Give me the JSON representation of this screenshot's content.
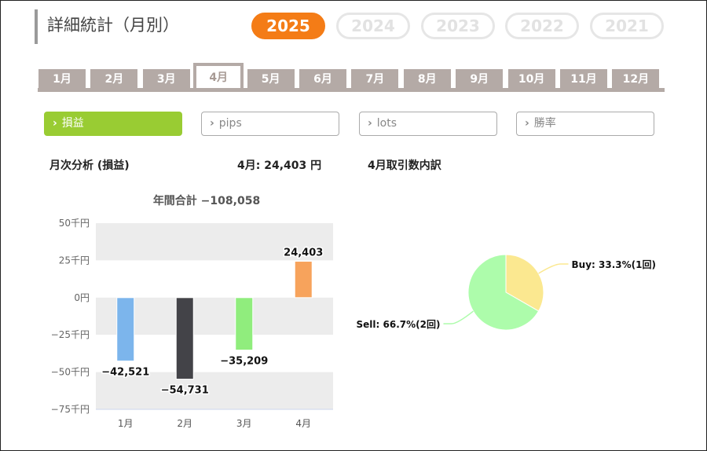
{
  "header": {
    "title": "詳細統計（月別）"
  },
  "years": [
    {
      "label": "2025",
      "active": true
    },
    {
      "label": "2024",
      "active": false
    },
    {
      "label": "2023",
      "active": false
    },
    {
      "label": "2022",
      "active": false
    },
    {
      "label": "2021",
      "active": false
    }
  ],
  "months": [
    "1月",
    "2月",
    "3月",
    "4月",
    "5月",
    "6月",
    "7月",
    "8月",
    "9月",
    "10月",
    "11月",
    "12月"
  ],
  "active_month_index": 3,
  "metrics": [
    {
      "label": "損益",
      "active": true
    },
    {
      "label": "pips",
      "active": false
    },
    {
      "label": "lots",
      "active": false
    },
    {
      "label": "勝率",
      "active": false
    }
  ],
  "summary": {
    "monthly_heading": "月次分析 (損益)",
    "month_value": "4月:  24,403 円",
    "trades_heading": "4月取引数内訳",
    "annual_total": "年間合計 −108,058"
  },
  "colors": {
    "accent_orange": "#f47c16",
    "metric_green": "#99cc33",
    "tab_gray": "#b4aaa6"
  },
  "chart_data": [
    {
      "type": "bar",
      "title": "年間合計 −108,058",
      "categories": [
        "1月",
        "2月",
        "3月",
        "4月"
      ],
      "values": [
        -42521,
        -54731,
        -35209,
        24403
      ],
      "value_labels": [
        "−42,521",
        "−54,731",
        "−35,209",
        "24,403"
      ],
      "bar_colors": [
        "#7cb5ec",
        "#434348",
        "#90ed7d",
        "#f7a35c"
      ],
      "ylim": [
        -75000,
        50000
      ],
      "yticks": [
        50000,
        25000,
        0,
        -25000,
        -50000,
        -75000
      ],
      "ytick_labels": [
        "50千円",
        "25千円",
        "0円",
        "−25千円",
        "−50千円",
        "−75千円"
      ],
      "grid": "alternating bands",
      "legend": "none"
    },
    {
      "type": "pie",
      "slices": [
        {
          "label": "Buy: 33.3%(1回)",
          "value": 33.3,
          "count": 1,
          "color": "#fbe890"
        },
        {
          "label": "Sell: 66.7%(2回)",
          "value": 66.7,
          "count": 2,
          "color": "#adfcab"
        }
      ]
    }
  ]
}
